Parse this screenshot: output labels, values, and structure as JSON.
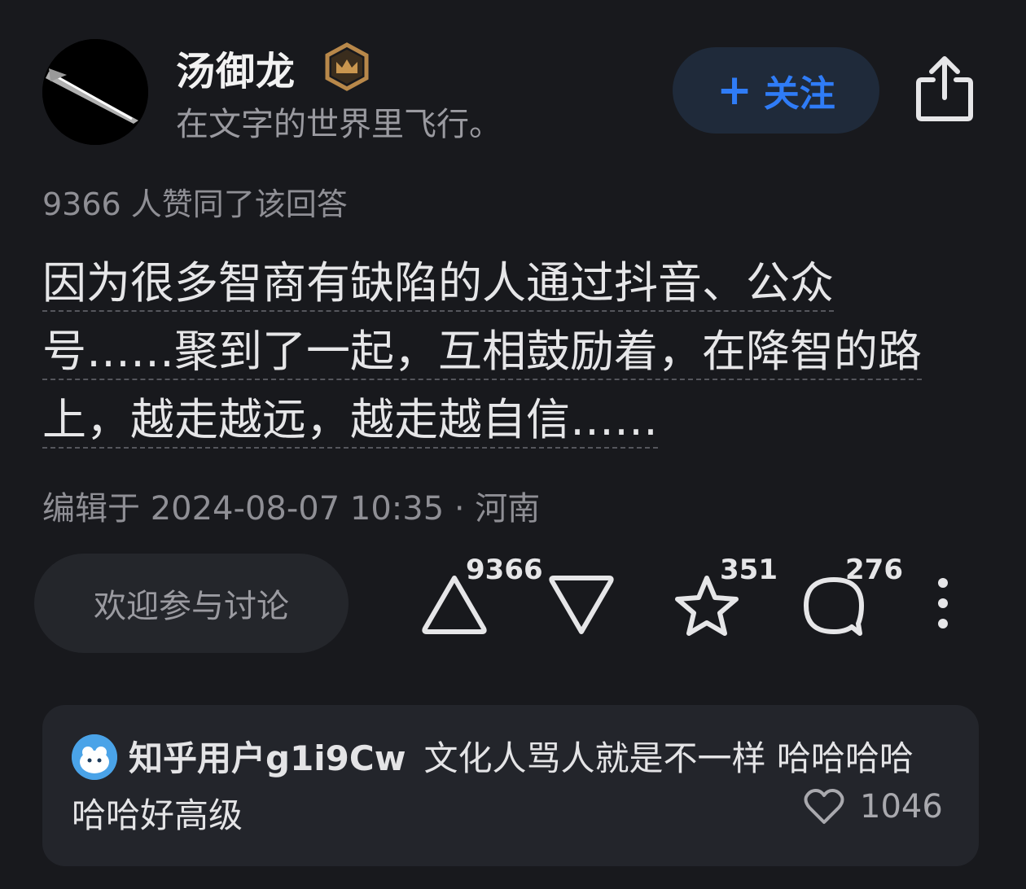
{
  "author": {
    "name": "汤御龙",
    "bio": "在文字的世界里飞行。",
    "badge_icon": "crown-icon"
  },
  "follow_button": {
    "plus": "+",
    "label": "关注"
  },
  "answer": {
    "vote_line": "9366 人赞同了该回答",
    "lines": [
      "因为很多智商有缺陷的人通过抖音、公众",
      "号……聚到了一起，互相鼓励着，在降智的路",
      "上，越走越远，越走越自信……"
    ],
    "meta": "编辑于 2024-08-07 10:35 · 河南"
  },
  "action_bar": {
    "discuss_placeholder": "欢迎参与讨论",
    "upvote_count": "9366",
    "favorite_count": "351",
    "comment_count": "276"
  },
  "comment": {
    "user": "知乎用户g1i9Cw",
    "text_line1": "文化人骂人就是不一样 哈哈哈哈",
    "text_line2": "哈哈好高级",
    "likes": "1046"
  },
  "colors": {
    "background": "#18191d",
    "accent_blue": "#2f7cf7",
    "badge_gold": "#b8884a"
  }
}
